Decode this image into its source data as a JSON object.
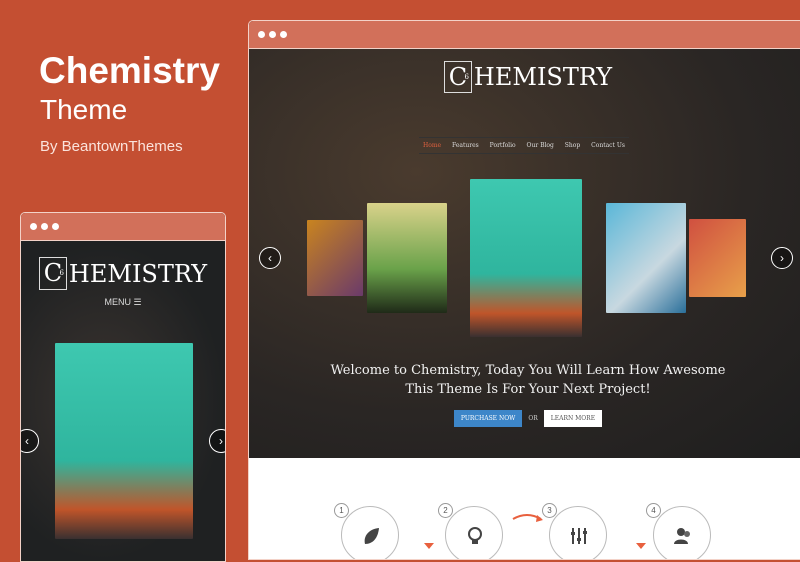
{
  "promo": {
    "title": "Chemistry",
    "subtitle": "Theme",
    "byline": "By BeantownThemes"
  },
  "brand": {
    "logo_letter": "C",
    "logo_sup": "6",
    "logo_rest": "HEMISTRY",
    "accent": "#c44f32",
    "button_blue": "#3d86c9"
  },
  "nav": {
    "items": [
      "Home",
      "Features",
      "Portfolio",
      "Our Blog",
      "Shop",
      "Contact Us"
    ],
    "active": "Home"
  },
  "mobile": {
    "menu_label": "MENU"
  },
  "hero": {
    "line1": "Welcome to Chemistry, Today You Will Learn How Awesome",
    "line2": "This Theme Is For Your Next Project!",
    "purchase": "PURCHASE NOW",
    "or": "OR",
    "learn": "LEARN MORE"
  },
  "steps": [
    {
      "num": "1",
      "icon": "leaf-icon"
    },
    {
      "num": "2",
      "icon": "lightbulb-icon"
    },
    {
      "num": "3",
      "icon": "sliders-icon"
    },
    {
      "num": "4",
      "icon": "users-icon"
    }
  ]
}
